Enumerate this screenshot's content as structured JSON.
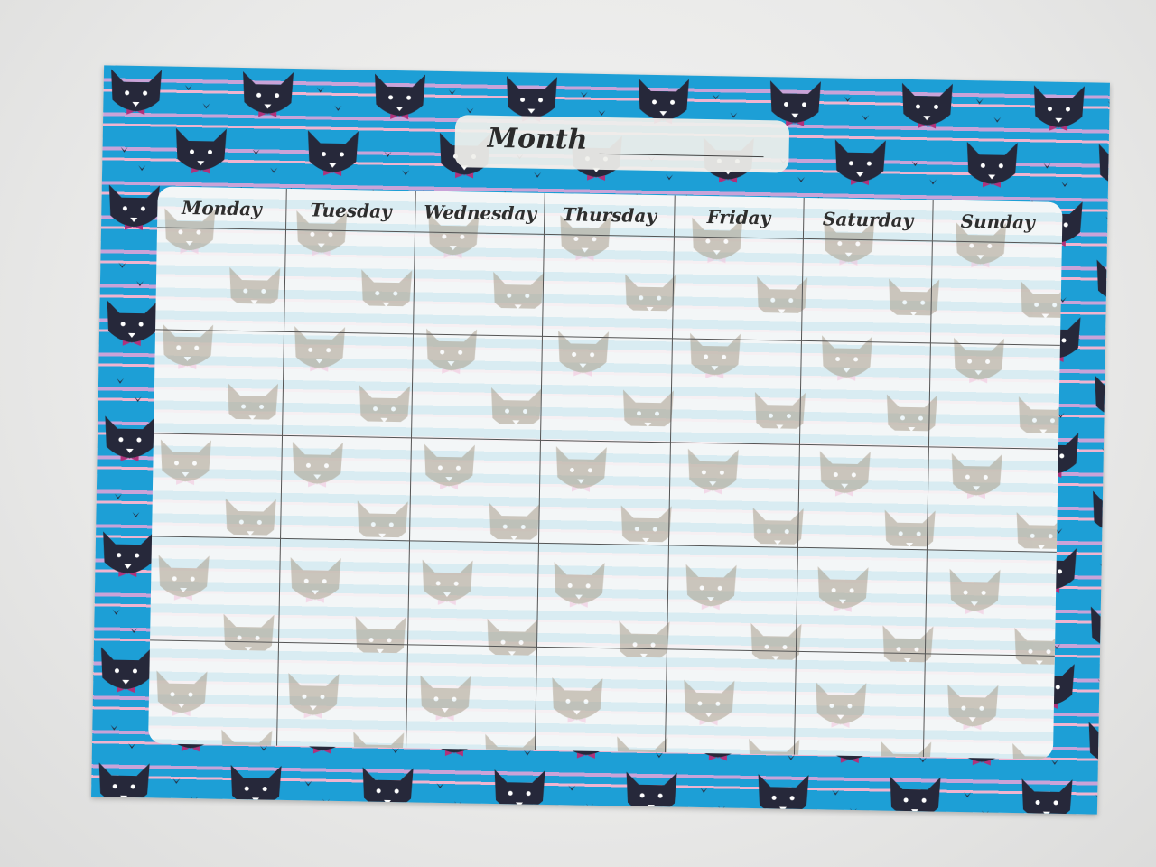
{
  "calendar": {
    "month_label": "Month",
    "days": [
      "Monday",
      "Tuesday",
      "Wednesday",
      "Thursday",
      "Friday",
      "Saturday",
      "Sunday"
    ],
    "weeks": 5
  },
  "colors": {
    "border_blue": "#1d9fd6",
    "stripe_pink": "#f0b4d0",
    "cat": "#26283a",
    "bow": "#b0327a",
    "panel": "#f3f6f7"
  }
}
